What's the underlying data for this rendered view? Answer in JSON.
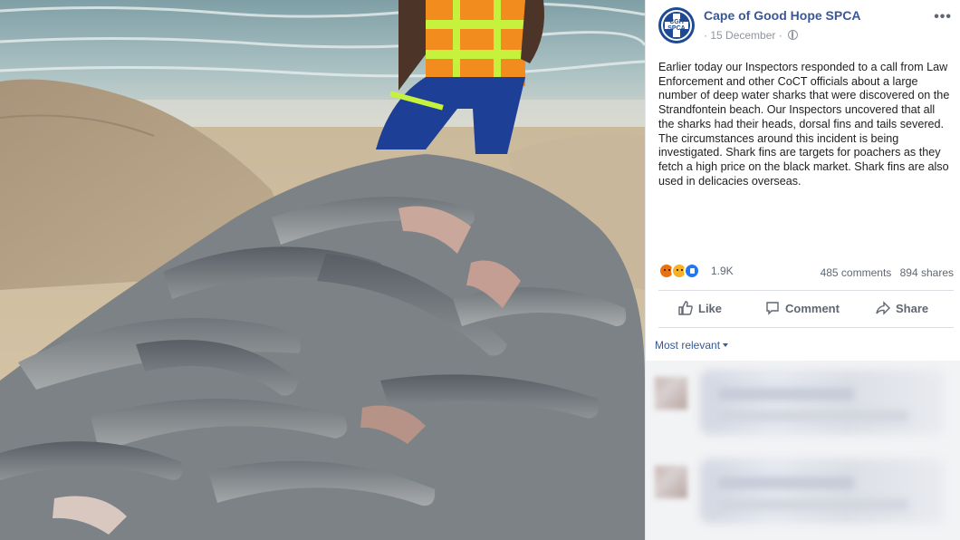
{
  "post": {
    "page_name": "Cape of Good Hope SPCA",
    "avatar_text": "CGH\nSPCA",
    "date": "15 December",
    "separator": "·",
    "text": "Earlier today our Inspectors responded to a call from Law Enforcement and other CoCT officials about a large number of deep water sharks that were discovered on the Strandfontein beach. Our Inspectors uncovered that all the sharks had their heads, dorsal fins and tails severed. The circumstances around this incident is being investigated. Shark fins are targets for poachers as they fetch a high price on the black market. Shark fins are also used in delicacies overseas.",
    "more_label": "•••"
  },
  "stats": {
    "reactions": [
      "angry-react-icon",
      "sad-react-icon",
      "like-react-icon"
    ],
    "reaction_count": "1.9K",
    "comments": "485 comments",
    "shares": "894 shares"
  },
  "actions": {
    "like": "Like",
    "comment": "Comment",
    "share": "Share"
  },
  "comments_filter": "Most relevant",
  "colors": {
    "link": "#385898",
    "text": "#1c1e21",
    "muted": "#606770",
    "angry": "#e9710f",
    "sad": "#f7b125",
    "like": "#2078f4",
    "vest": "#f28c1e",
    "vest_stripe": "#c6f13c",
    "trousers": "#1e3f96"
  }
}
